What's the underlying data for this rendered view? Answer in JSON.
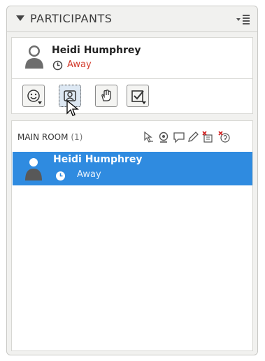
{
  "header": {
    "title": "PARTICIPANTS",
    "collapse_icon": "triangle-down-icon",
    "menu_icon": "panel-menu-icon"
  },
  "current_user": {
    "name": "Heidi Humphrey",
    "status": "Away",
    "avatar_icon": "user-silhouette-icon",
    "status_icon": "clock-icon"
  },
  "toolbar": {
    "buttons": [
      {
        "name": "emoticon",
        "icon": "smiley-icon",
        "has_dropdown": true
      },
      {
        "name": "webcam",
        "icon": "webcam-person-icon",
        "has_dropdown": false,
        "active": true
      },
      {
        "name": "raise-hand",
        "icon": "hand-icon",
        "has_dropdown": false
      },
      {
        "name": "poll",
        "icon": "checkbox-icon",
        "has_dropdown": true
      }
    ]
  },
  "room": {
    "label": "MAIN ROOM",
    "count": "(1)",
    "tools": [
      "pointer-edit-icon",
      "webcam-icon",
      "chat-icon",
      "pencil-icon",
      "remove-moderator-icon",
      "remove-audio-icon"
    ],
    "participants": [
      {
        "name": "Heidi Humphrey",
        "status": "Away",
        "selected": true
      }
    ]
  },
  "colors": {
    "selection": "#2f8be0",
    "away_status": "#d23a2b",
    "panel_bg": "#f1f1ef"
  }
}
